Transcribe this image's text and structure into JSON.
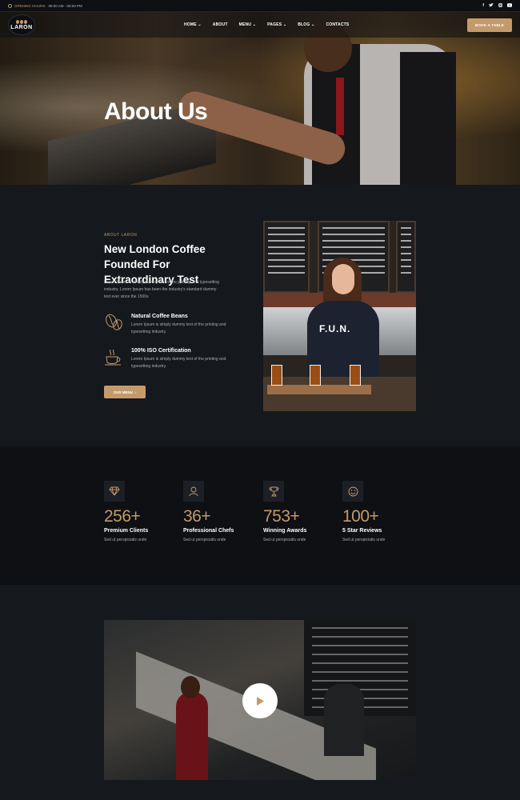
{
  "topbar": {
    "hours_label": "OPENING HOURS:",
    "hours_value": "08:00 AM - 09:00 PM",
    "social": [
      "f",
      "t",
      "ig",
      "yt"
    ]
  },
  "nav": {
    "logo_text": "LARON",
    "items": [
      {
        "label": "HOME",
        "has_dropdown": true
      },
      {
        "label": "ABOUT",
        "has_dropdown": false
      },
      {
        "label": "MENU",
        "has_dropdown": true
      },
      {
        "label": "PAGES",
        "has_dropdown": true
      },
      {
        "label": "BLOG",
        "has_dropdown": true
      },
      {
        "label": "CONTACTS",
        "has_dropdown": false
      }
    ],
    "book_label": "BOOK A TABLE"
  },
  "hero": {
    "title": "About Us"
  },
  "about": {
    "eyebrow": "ABOUT LARON",
    "heading": "New London Coffee Founded For Extraordinary Test",
    "description": "Lorem Ipsum is simply dummy text of the printing and typesetting industry. Lorem Ipsum has been the industry's standard dummy text ever since the 1500s",
    "features": [
      {
        "icon": "coffee-beans-icon",
        "title": "Natural Coffee Beans",
        "desc": "Lorem Ipsum is simply dummy text of the printing and typesetting industry."
      },
      {
        "icon": "coffee-cup-icon",
        "title": "100% ISO Certification",
        "desc": "Lorem Ipsum is simply dummy text of the printing and typesetting industry."
      }
    ],
    "button_label": "OUR MENU",
    "photo_shirt_text": "F.U.N."
  },
  "stats": [
    {
      "icon": "diamond-icon",
      "value": "256+",
      "label": "Premium Clients",
      "desc": "Sed ut perspiciatis unde"
    },
    {
      "icon": "chef-icon",
      "value": "36+",
      "label": "Professional Chefs",
      "desc": "Sed ut perspiciatis unde"
    },
    {
      "icon": "trophy-icon",
      "value": "753+",
      "label": "Winning Awards",
      "desc": "Sed ut perspiciatis unde"
    },
    {
      "icon": "smiley-icon",
      "value": "100+",
      "label": "5 Star Reviews",
      "desc": "Sed ut perspiciatis unde"
    }
  ],
  "colors": {
    "accent": "#c49a6c",
    "background": "#15181c",
    "stats_background": "#0e1013"
  }
}
